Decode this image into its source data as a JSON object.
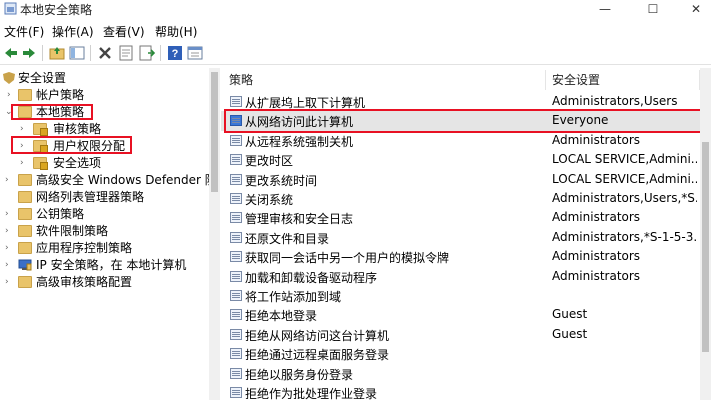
{
  "window": {
    "title": "本地安全策略",
    "minimize_glyph": "—",
    "maximize_glyph": "☐",
    "close_glyph": "✕"
  },
  "menu": [
    "文件(F)",
    "操作(A)",
    "查看(V)",
    "帮助(H)"
  ],
  "toolbar": {
    "icons": [
      "back-arrow-icon",
      "forward-arrow-icon",
      "up-folder-icon",
      "show-hide-tree-icon",
      "delete-icon",
      "properties-icon",
      "export-list-icon",
      "help-icon",
      "console-icon"
    ]
  },
  "tree": {
    "root": "安全设置",
    "account_policy": "帐户策略",
    "local_policy": "本地策略",
    "audit_policy": "审核策略",
    "user_rights": "用户权限分配",
    "security_options": "安全选项",
    "defender_firewall": "高级安全 Windows Defender 防火墙",
    "network_list": "网络列表管理器策略",
    "public_key": "公钥策略",
    "software_restriction": "软件限制策略",
    "app_control": "应用程序控制策略",
    "ip_security": "IP 安全策略，在 本地计算机",
    "advanced_audit": "高级审核策略配置"
  },
  "columns": {
    "policy": "策略",
    "setting": "安全设置"
  },
  "rows": [
    {
      "policy": "从扩展坞上取下计算机",
      "setting": "Administrators,Users"
    },
    {
      "policy": "从网络访问此计算机",
      "setting": "Everyone"
    },
    {
      "policy": "从远程系统强制关机",
      "setting": "Administrators"
    },
    {
      "policy": "更改时区",
      "setting": "LOCAL SERVICE,Admini..."
    },
    {
      "policy": "更改系统时间",
      "setting": "LOCAL SERVICE,Admini..."
    },
    {
      "policy": "关闭系统",
      "setting": "Administrators,Users,*S..."
    },
    {
      "policy": "管理审核和安全日志",
      "setting": "Administrators"
    },
    {
      "policy": "还原文件和目录",
      "setting": "Administrators,*S-1-5-3..."
    },
    {
      "policy": "获取同一会话中另一个用户的模拟令牌",
      "setting": "Administrators"
    },
    {
      "policy": "加载和卸载设备驱动程序",
      "setting": "Administrators"
    },
    {
      "policy": "将工作站添加到域",
      "setting": ""
    },
    {
      "policy": "拒绝本地登录",
      "setting": "Guest"
    },
    {
      "policy": "拒绝从网络访问这台计算机",
      "setting": "Guest"
    },
    {
      "policy": "拒绝通过远程桌面服务登录",
      "setting": ""
    },
    {
      "policy": "拒绝以服务身份登录",
      "setting": ""
    },
    {
      "policy": "拒绝作为批处理作业登录",
      "setting": ""
    }
  ],
  "colors": {
    "highlight": "#e81123",
    "selected_row": "#e5e5e5",
    "folder": "#e9c46a"
  }
}
